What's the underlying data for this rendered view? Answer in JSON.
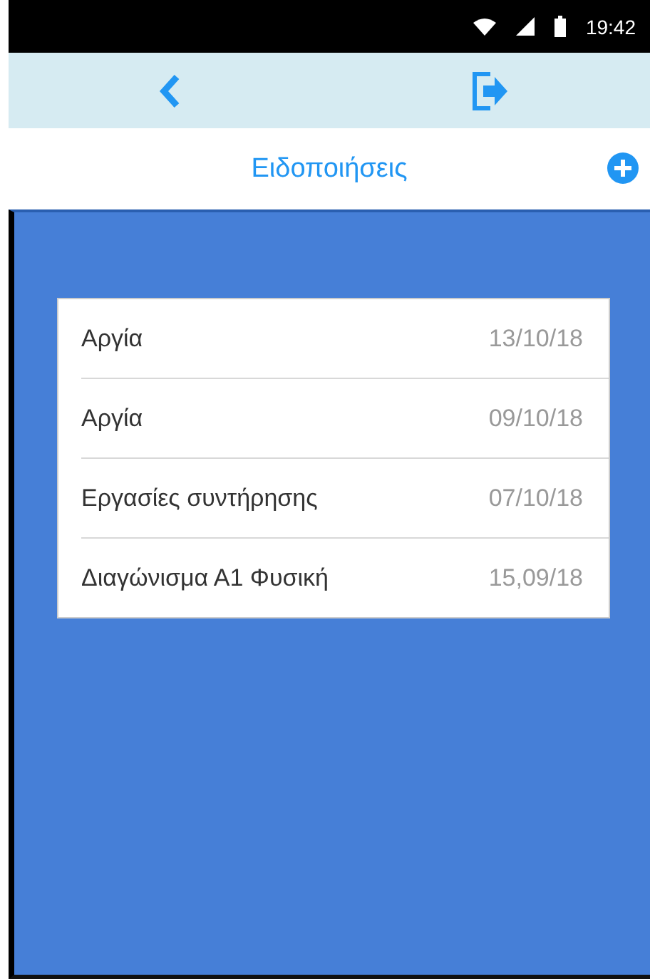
{
  "status_bar": {
    "time": "19:42"
  },
  "header": {
    "title": "Ειδοποιήσεις"
  },
  "notifications": [
    {
      "title": "Αργία",
      "date": "13/10/18"
    },
    {
      "title": "Αργία",
      "date": "09/10/18"
    },
    {
      "title": "Εργασίες συντήρησης",
      "date": "07/10/18"
    },
    {
      "title": "Διαγώνισμα Α1 Φυσική",
      "date": "15,09/18"
    }
  ]
}
